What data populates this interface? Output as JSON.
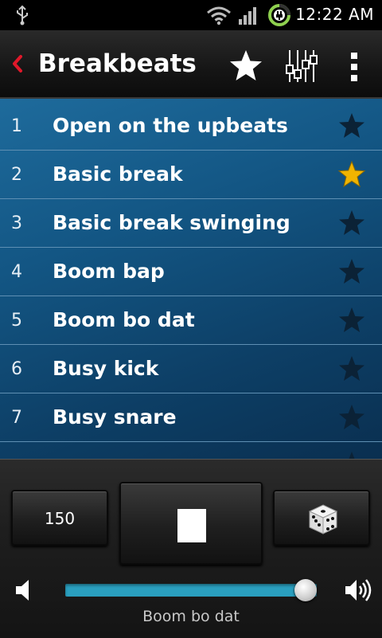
{
  "status_bar": {
    "time": "12:22 AM",
    "icons": [
      "usb-icon",
      "wifi-icon",
      "signal-icon",
      "battery-charging-icon"
    ]
  },
  "action_bar": {
    "title": "Breakbeats",
    "back_icon": "chevron-left-icon",
    "actions": [
      "favorite-star-icon",
      "mixer-icon",
      "overflow-menu-icon"
    ],
    "back_color": "#e0182a"
  },
  "beats": [
    {
      "number": "1",
      "name": "Open on the upbeats",
      "favorite": false
    },
    {
      "number": "2",
      "name": "Basic break",
      "favorite": true
    },
    {
      "number": "3",
      "name": "Basic break swinging",
      "favorite": false
    },
    {
      "number": "4",
      "name": "Boom bap",
      "favorite": false
    },
    {
      "number": "5",
      "name": "Boom bo dat",
      "favorite": false
    },
    {
      "number": "6",
      "name": "Busy kick",
      "favorite": false
    },
    {
      "number": "7",
      "name": "Busy snare",
      "favorite": false
    }
  ],
  "colors": {
    "star_favorite": "#f0b400",
    "star_default": "#0b2236",
    "slider_track": "#2a9fbf"
  },
  "controls": {
    "tempo": "150",
    "stop_icon": "stop-icon",
    "random_icon": "dice-icon",
    "volume_low_icon": "volume-low-icon",
    "volume_high_icon": "volume-high-icon",
    "volume_level": 1.0,
    "now_playing": "Boom bo dat"
  }
}
